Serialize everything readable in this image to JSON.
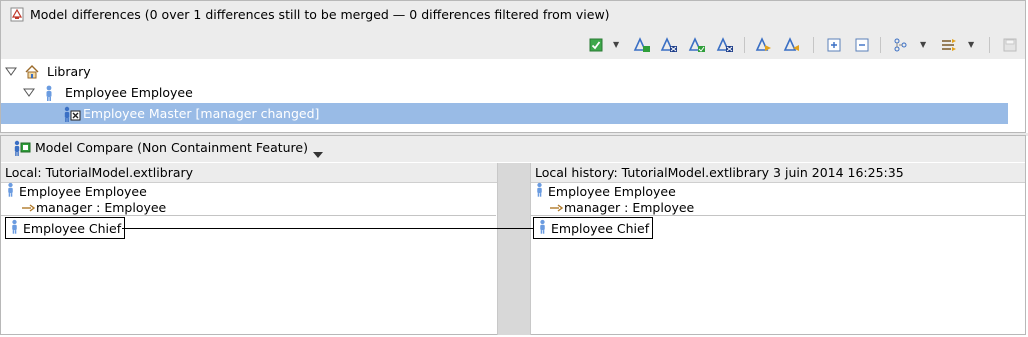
{
  "top_panel": {
    "title": "Model differences  (0 over 1 differences still to be merged — 0 differences filtered from view)",
    "title_icon": "diff-icon",
    "toolbar": [
      "accept-all-icon",
      "accept-change-icon",
      "reject-change-icon",
      "accept-all-nonconflicting-icon",
      "reject-all-nonconflicting-icon",
      "next-difference-icon",
      "previous-difference-icon",
      "expand-all-icon",
      "collapse-all-icon",
      "group-icon",
      "filter-icon",
      "save-icon"
    ]
  },
  "tree": {
    "root": "Library",
    "child": "Employee Employee",
    "selected": "Employee Master [manager changed]"
  },
  "bottom_panel": {
    "title": "Model Compare (Non Containment Feature)",
    "left": {
      "header": "Local: TutorialModel.extlibrary",
      "object": "Employee Employee",
      "feature": "manager : Employee",
      "value": "Employee Chief"
    },
    "right": {
      "header": "Local history: TutorialModel.extlibrary 3 juin 2014 16:25:35",
      "object": "Employee Employee",
      "feature": "manager : Employee",
      "value": "Employee Chief"
    }
  },
  "colors": {
    "selection": "#99bbe6",
    "chrome": "#ececec",
    "gutter": "#d8d8d8",
    "accent_blue": "#3a6fc4",
    "accent_green": "#2f9e3a"
  }
}
